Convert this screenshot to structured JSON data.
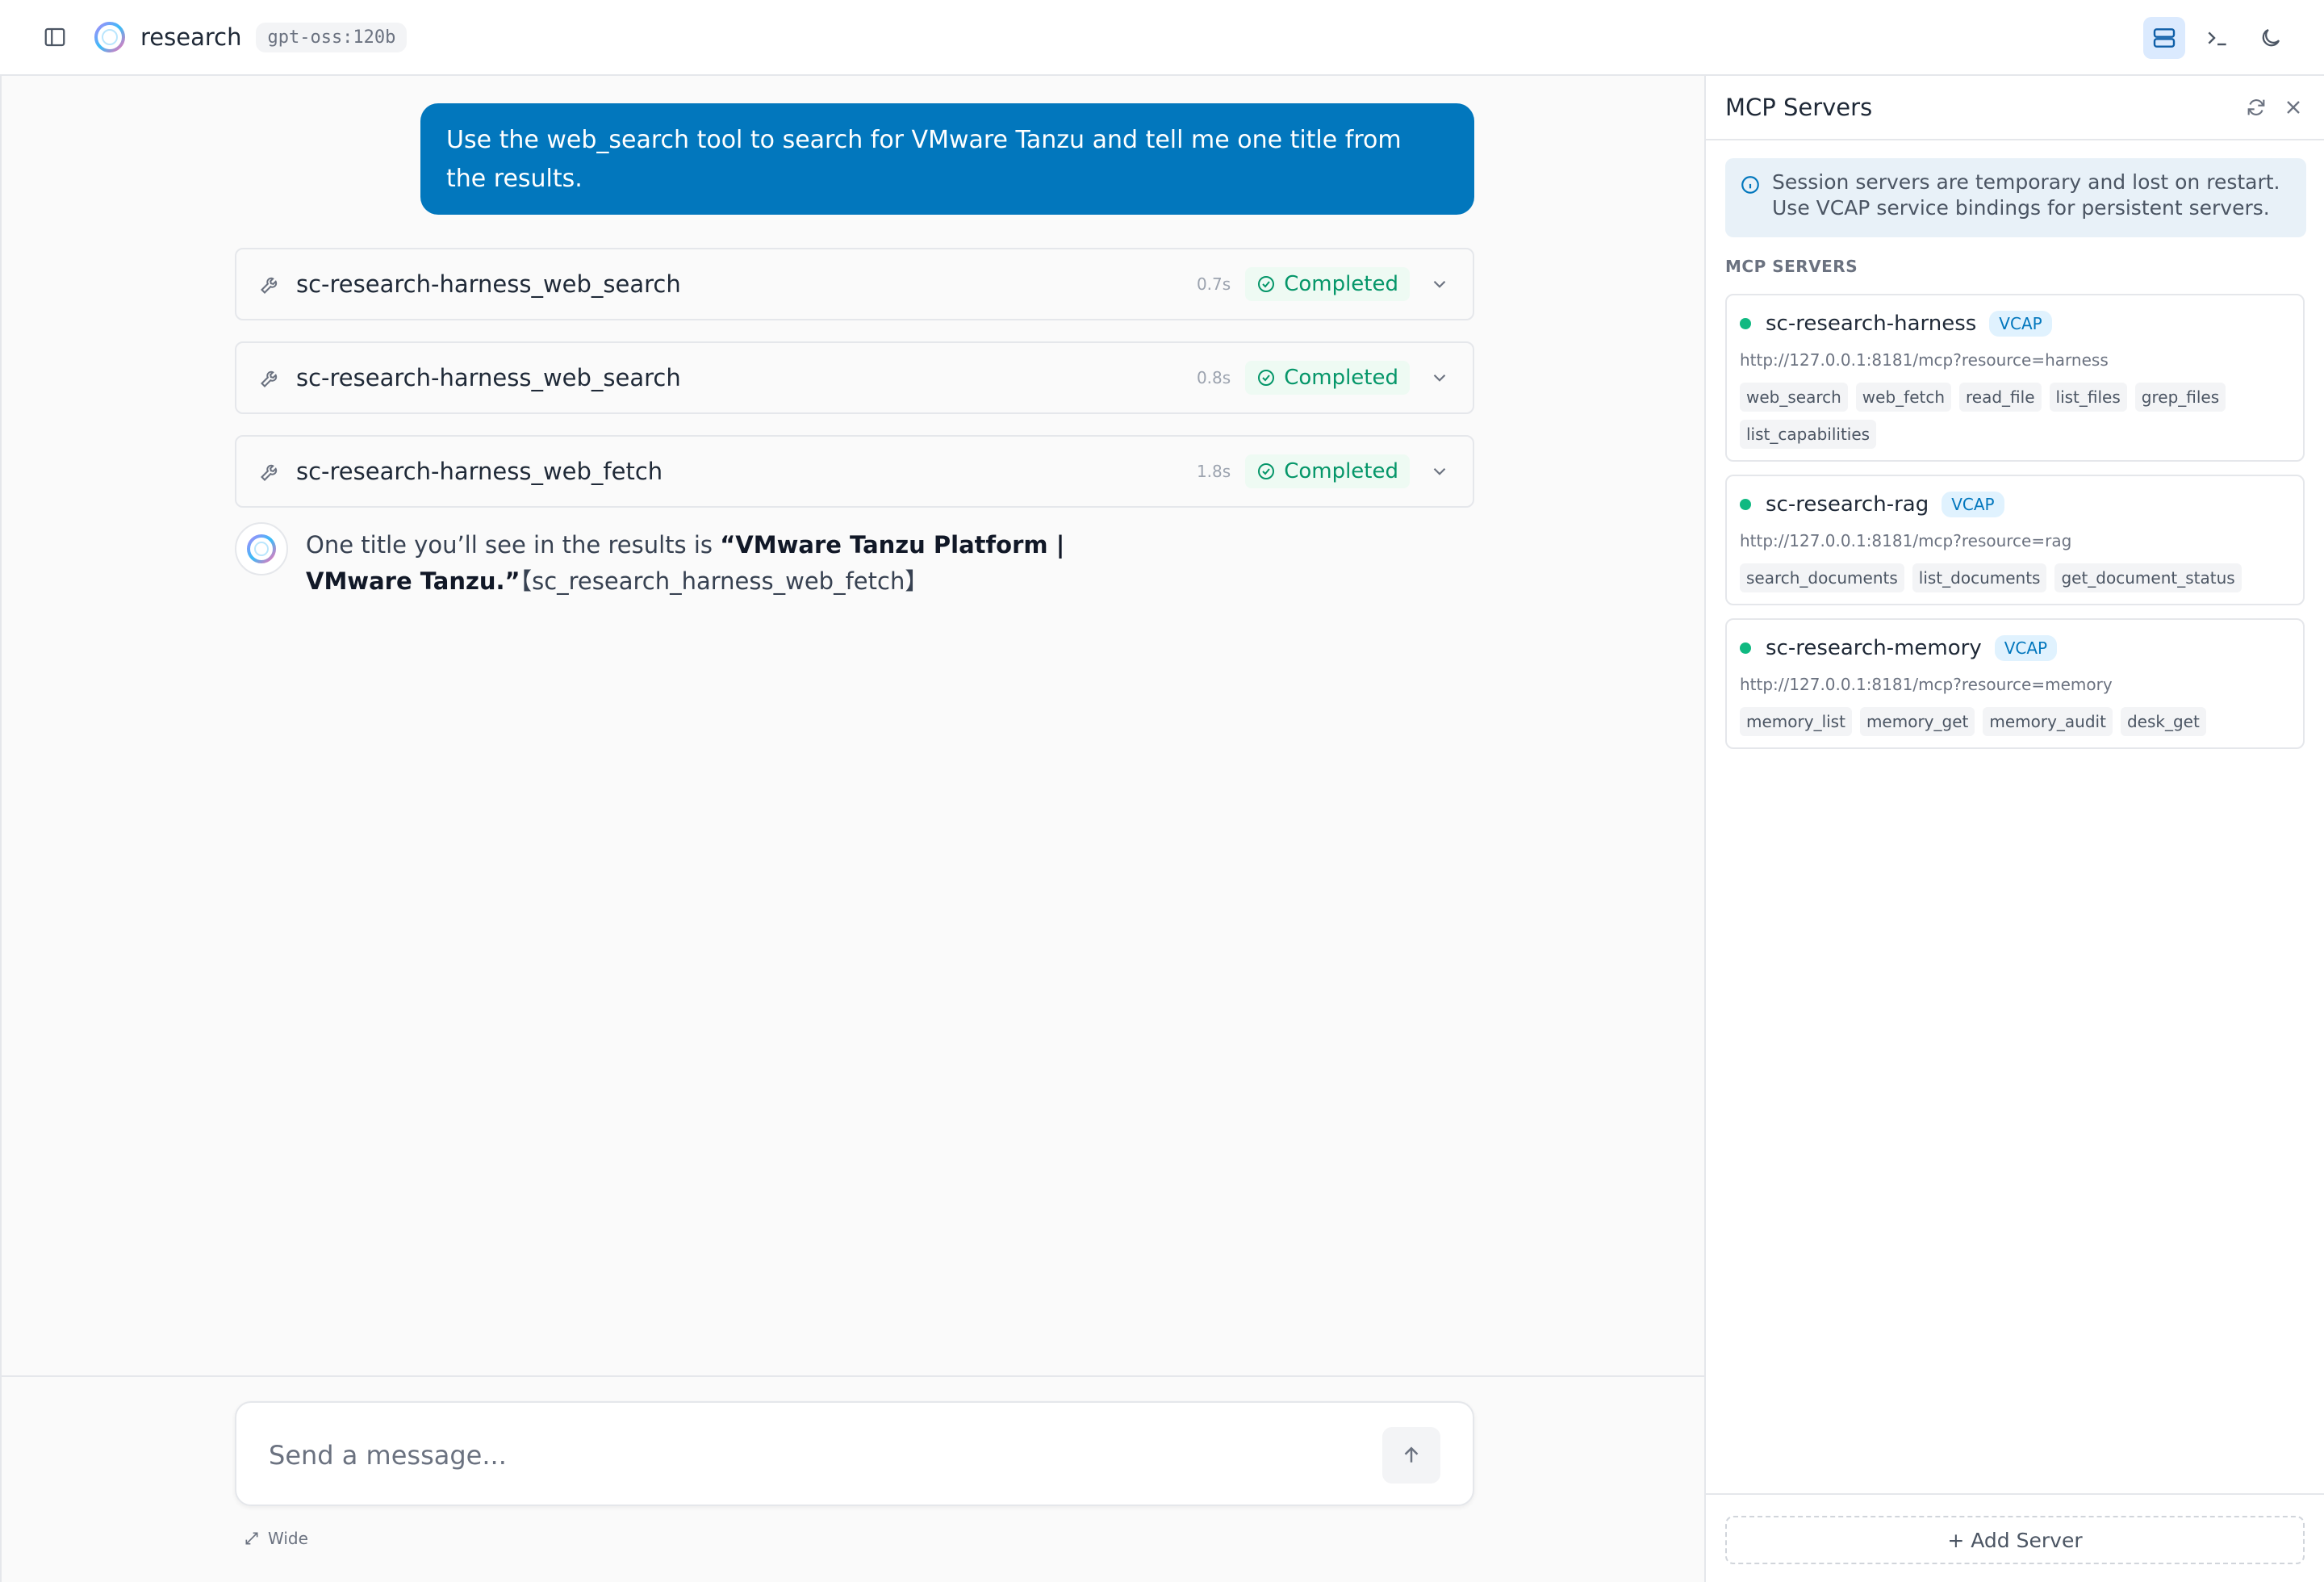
{
  "header": {
    "app_name": "research",
    "model": "gpt-oss:120b",
    "sidebar_toggle_icon": "sidebar-toggle-icon",
    "right_icons": [
      "servers-icon",
      "terminal-icon",
      "moon-icon"
    ]
  },
  "chat": {
    "user_message": "Use the web_search tool to search for VMware Tanzu and tell me one title from the results.",
    "tool_calls": [
      {
        "name": "sc-research-harness_web_search",
        "time": "0.7s",
        "status": "Completed"
      },
      {
        "name": "sc-research-harness_web_search",
        "time": "0.8s",
        "status": "Completed"
      },
      {
        "name": "sc-research-harness_web_fetch",
        "time": "1.8s",
        "status": "Completed"
      }
    ],
    "assistant": {
      "prefix": "One title you’ll see in the results is ",
      "bold": "“VMware Tanzu Platform | VMware Tanzu.”",
      "citation": "【sc_research_harness_web_fetch】"
    },
    "composer": {
      "placeholder": "Send a message...",
      "wide_label": "Wide"
    }
  },
  "panel": {
    "title": "MCP Servers",
    "info": "Session servers are temporary and lost on restart. Use VCAP service bindings for persistent servers.",
    "section_label": "MCP SERVERS",
    "servers": [
      {
        "name": "sc-research-harness",
        "badge": "VCAP",
        "url": "http://127.0.0.1:8181/mcp?resource=harness",
        "tools": [
          "web_search",
          "web_fetch",
          "read_file",
          "list_files",
          "grep_files",
          "list_capabilities"
        ]
      },
      {
        "name": "sc-research-rag",
        "badge": "VCAP",
        "url": "http://127.0.0.1:8181/mcp?resource=rag",
        "tools": [
          "search_documents",
          "list_documents",
          "get_document_status"
        ]
      },
      {
        "name": "sc-research-memory",
        "badge": "VCAP",
        "url": "http://127.0.0.1:8181/mcp?resource=memory",
        "tools": [
          "memory_list",
          "memory_get",
          "memory_audit",
          "desk_get"
        ]
      }
    ],
    "add_server_label": "+ Add Server"
  },
  "colors": {
    "accent": "#0277bd",
    "success": "#059669",
    "status_dot": "#10b981"
  }
}
